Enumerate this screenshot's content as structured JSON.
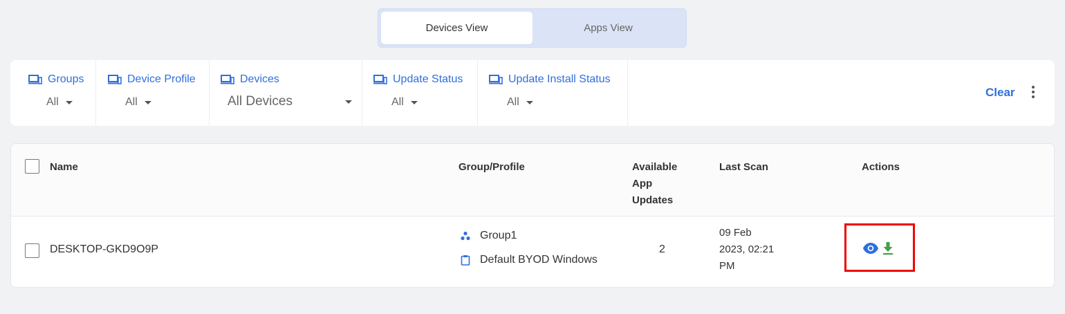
{
  "view_toggle": {
    "tabs": [
      {
        "label": "Devices View"
      },
      {
        "label": "Apps View"
      }
    ]
  },
  "filters": [
    {
      "label": "Groups",
      "value": "All"
    },
    {
      "label": "Device Profile",
      "value": "All"
    },
    {
      "label": "Devices",
      "value": "All Devices"
    },
    {
      "label": "Update Status",
      "value": "All"
    },
    {
      "label": "Update Install Status",
      "value": "All"
    }
  ],
  "filter_actions": {
    "clear": "Clear"
  },
  "table": {
    "headers": {
      "name": "Name",
      "group_profile": "Group/Profile",
      "available_updates_1": "Available",
      "available_updates_2": "App",
      "available_updates_3": "Updates",
      "last_scan": "Last Scan",
      "actions": "Actions"
    },
    "rows": [
      {
        "name": "DESKTOP-GKD9O9P",
        "group": "Group1",
        "profile": "Default BYOD Windows",
        "available_updates": "2",
        "last_scan_1": "09 Feb",
        "last_scan_2": "2023, 02:21",
        "last_scan_3": "PM"
      }
    ]
  },
  "colors": {
    "accent": "#2f6fdc",
    "download": "#43a047",
    "highlight": "#ee0000"
  }
}
